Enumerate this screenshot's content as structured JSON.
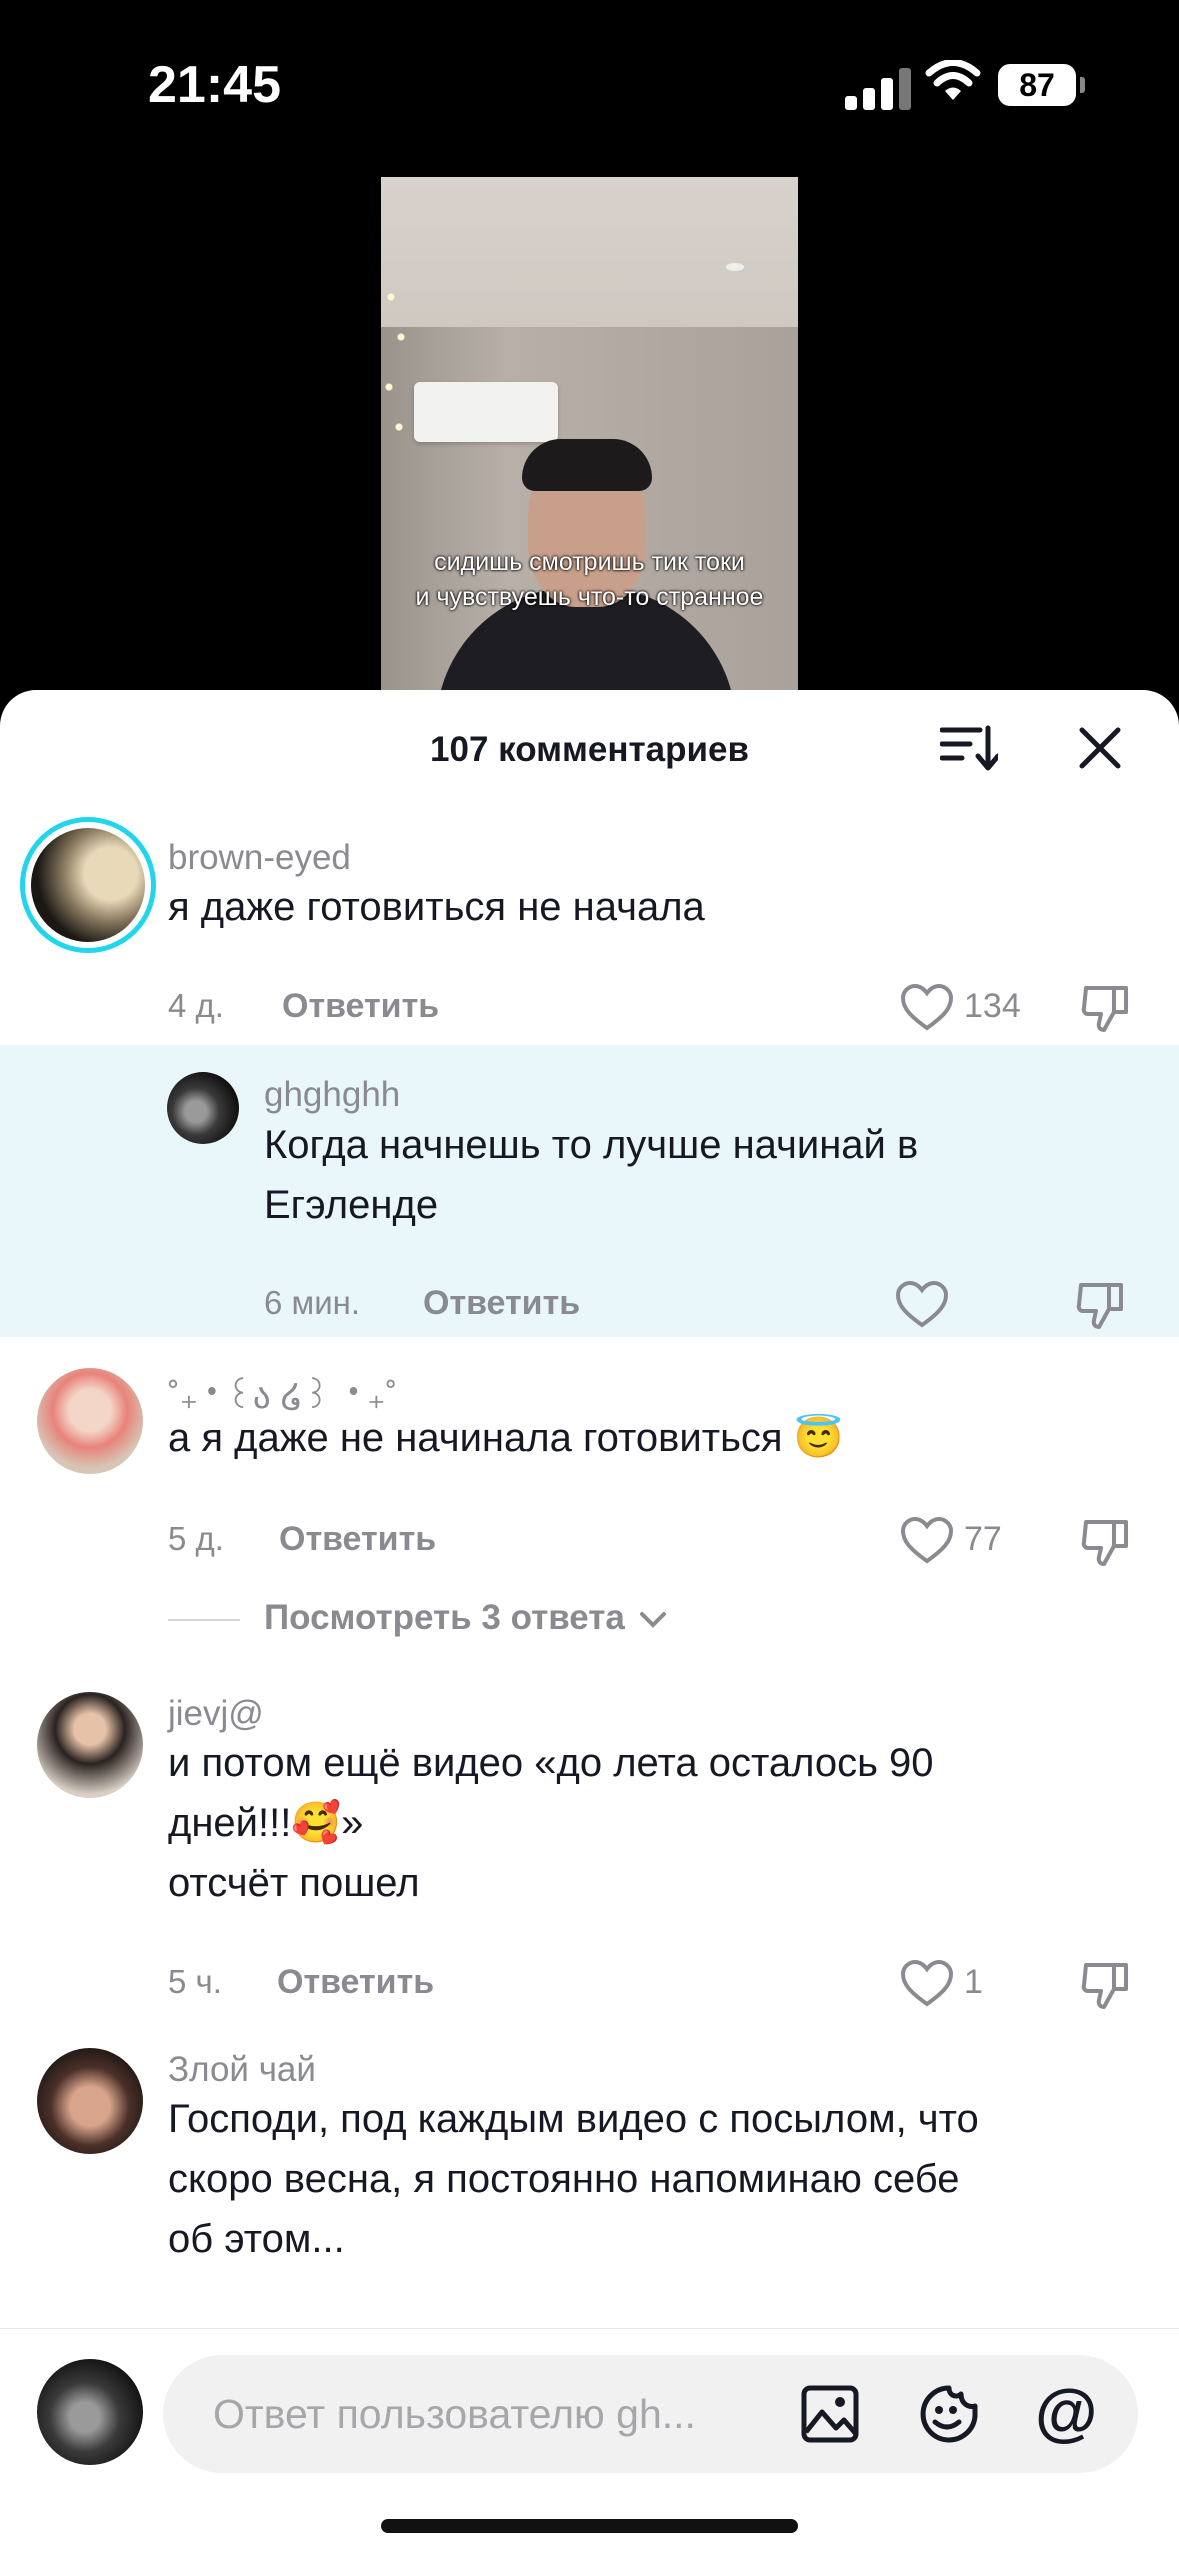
{
  "status_bar": {
    "time": "21:45",
    "battery": "87"
  },
  "video": {
    "subtitle_line1": "сидишь смотришь тик токи",
    "subtitle_line2": "и чувствуешь что-то странное"
  },
  "sheet": {
    "title": "107 комментариев"
  },
  "comments": [
    {
      "user": "brown-eyed",
      "text": "я даже готовиться не начала",
      "age": "4 д.",
      "reply": "Ответить",
      "likes": "134"
    },
    {
      "user": "ghghghh",
      "text_line1": "Когда начнешь то лучше начинай в",
      "text_line2": "Егэленде",
      "age": "6 мин.",
      "reply": "Ответить"
    },
    {
      "user": "˚₊‧꒰ა ໒꒱ ‧₊˚",
      "text": "а я даже не начинала готовиться 😇",
      "age": "5 д.",
      "reply": "Ответить",
      "likes": "77",
      "view_replies": "Посмотреть 3 ответа"
    },
    {
      "user": "jievj@",
      "text_line1": "и потом ещё видео «до лета осталось 90",
      "text_line2": "дней!!!🥰»",
      "text_line3": "отсчёт пошел",
      "age": "5 ч.",
      "reply": "Ответить",
      "likes": "1"
    },
    {
      "user": "Злой чай",
      "text_line1": "Господи, под каждым видео с посылом, что",
      "text_line2": "скоро весна, я постоянно напоминаю себе",
      "text_line3": "об этом..."
    }
  ],
  "composer": {
    "placeholder": "Ответ пользователю gh..."
  },
  "icons": {
    "sort": "sort-icon",
    "close": "close-icon",
    "like": "heart-icon",
    "dislike": "thumbs-down-icon",
    "image": "image-icon",
    "emoji": "emoji-icon",
    "mention": "at-icon"
  }
}
